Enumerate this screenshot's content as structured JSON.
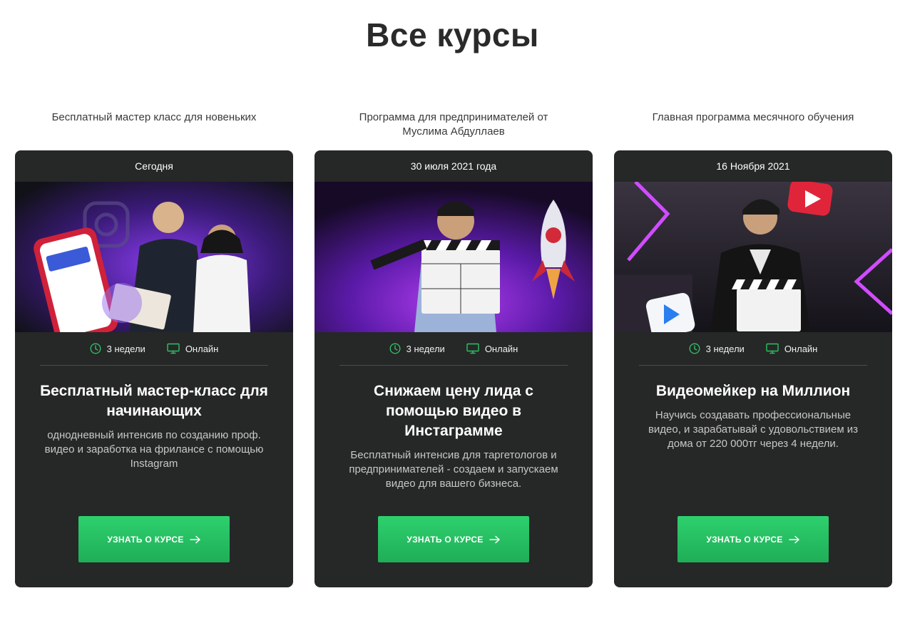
{
  "page": {
    "title": "Все курсы"
  },
  "courses": [
    {
      "subtitle": "Бесплатный мастер класс для новеньких",
      "date": "Сегодня",
      "duration": "3 недели",
      "format": "Онлайн",
      "heading": "Бесплатный мастер-класс для начинающих",
      "description": "однодневный интенсив по созданию проф. видео и заработка на фрилансе с помощью Instagram",
      "button": "УЗНАТЬ О КУРСЕ",
      "image_accent": "#6b2fd6"
    },
    {
      "subtitle": "Программа для предпринимателей от Муслима Абдуллаев",
      "date": "30 июля 2021 года",
      "duration": "3 недели",
      "format": "Онлайн",
      "heading": "Снижаем цену лида с помощью видео в Инстаграмме",
      "description": "Бесплатный интенсив для таргетологов и предпринимателей - создаем и запускаем видео для вашего бизнеса.",
      "button": "УЗНАТЬ О КУРСЕ",
      "image_accent": "#7a1fd0"
    },
    {
      "subtitle": "Главная программа месячного обучения",
      "date": "16 Ноября 2021",
      "duration": "3 недели",
      "format": "Онлайн",
      "heading": "Видеомейкер на Миллион",
      "description": "Научись создавать профессиональные видео, и зарабатывай с удовольствием из дома от 220 000тг через 4 недели.",
      "button": "УЗНАТЬ О КУРСЕ",
      "image_accent": "#c33cff"
    }
  ],
  "icons": {
    "duration": "clock-icon",
    "format": "monitor-icon",
    "button_arrow": "arrow-right-icon"
  },
  "colors": {
    "card_bg": "#262727",
    "button_green": "#28c264",
    "icon_green": "#2fbf64"
  }
}
